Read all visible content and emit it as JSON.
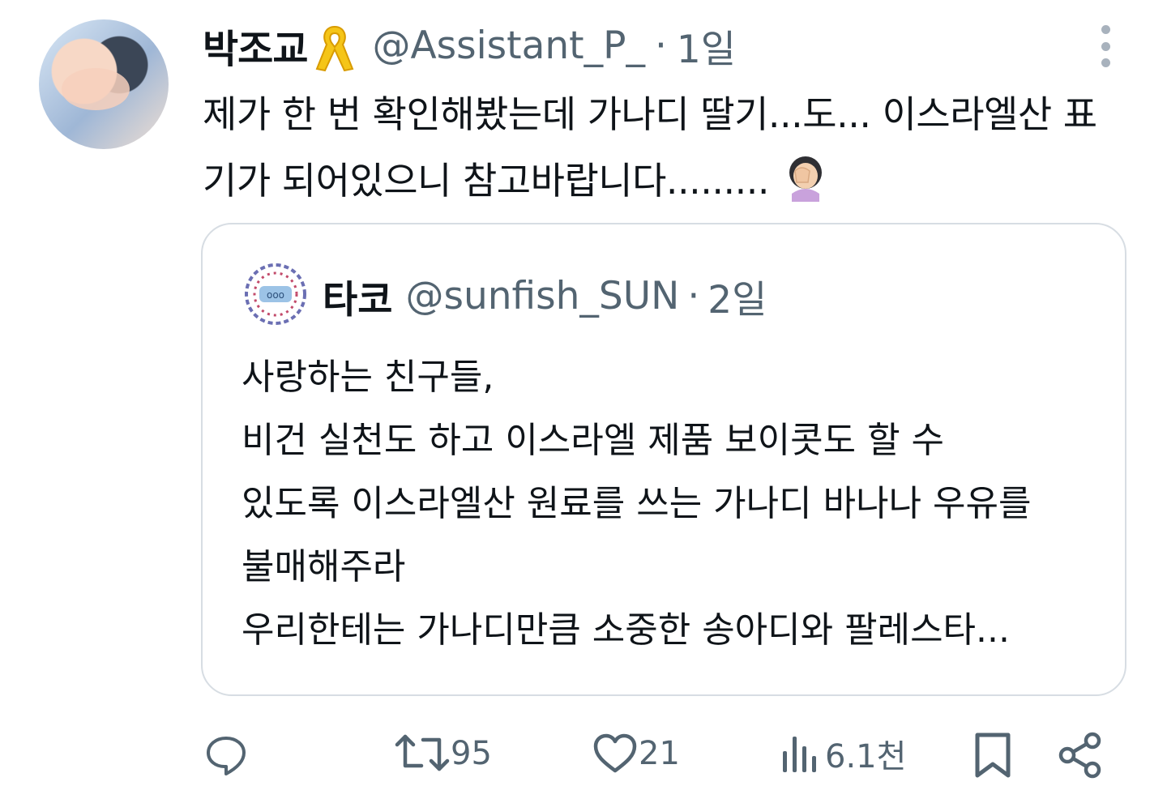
{
  "tweet": {
    "display_name": "박조교",
    "name_badge_icon": "yellow-ribbon-icon",
    "handle": "@Assistant_P_",
    "dot": "·",
    "time": "1일",
    "text": "제가 한 번 확인해봤는데 가나디 딸기...도... 이스라엘산 표기가 되어있으니 참고바랍니다.........",
    "emoji": "face-palm-icon"
  },
  "quote": {
    "display_name": "타코",
    "handle": "@sunfish_SUN",
    "dot": "·",
    "time": "2일",
    "text": "사랑하는 친구들,\n비건 실천도 하고 이스라엘 제품 보이콧도 할 수\n있도록 이스라엘산 원료를 쓰는 가나디 바나나 우유를\n불매해주라\n우리한테는 가나디만큼 소중한 송아디와 팔레스타..."
  },
  "actions": {
    "reply_count": "",
    "retweet_count": "95",
    "like_count": "21",
    "views_count": "6.1천"
  },
  "colors": {
    "text": "#0f1419",
    "secondary": "#536471",
    "border": "#d7dde3"
  }
}
